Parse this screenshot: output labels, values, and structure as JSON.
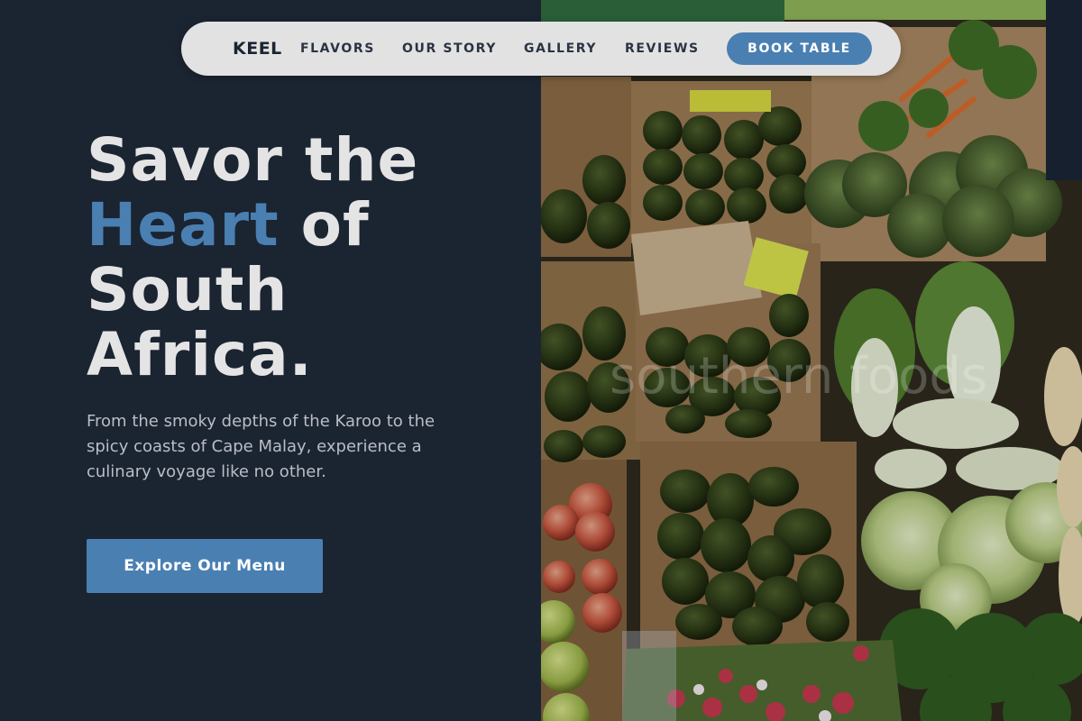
{
  "nav": {
    "logo": "KEEL",
    "links": [
      "FLAVORS",
      "OUR STORY",
      "GALLERY",
      "REVIEWS"
    ],
    "cta": "BOOK TABLE"
  },
  "hero": {
    "title_line1": "Savor the",
    "title_accent": "Heart",
    "title_line2_rest": " of",
    "title_line3": "South",
    "title_line4": "Africa.",
    "description": "From the smoky depths of the Karoo to the spicy coasts of Cape Malay, experience a culinary voyage like no other.",
    "button": "Explore Our Menu"
  },
  "image": {
    "watermark": "southern foods"
  },
  "colors": {
    "background": "#1b2431",
    "accent": "#4a7fb2",
    "nav_bg": "#e2e2e2"
  }
}
